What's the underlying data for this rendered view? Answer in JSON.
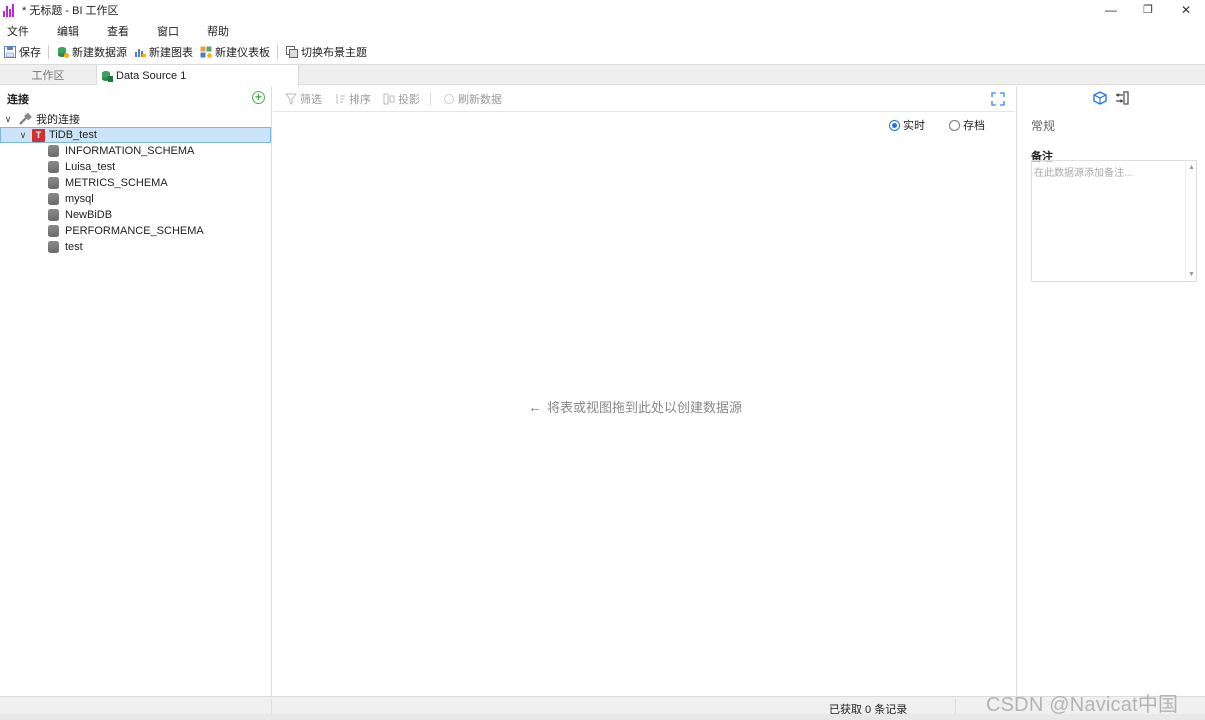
{
  "window": {
    "title": "* 无标题 - BI 工作区",
    "minimize_glyph": "—",
    "restore_glyph": "❐",
    "close_glyph": "✕"
  },
  "menu": [
    "文件",
    "编辑",
    "查看",
    "窗口",
    "帮助"
  ],
  "toolbar": {
    "save": "保存",
    "new_datasource": "新建数据源",
    "new_chart": "新建图表",
    "new_dashboard": "新建仪表板",
    "switch_theme": "切换布景主题"
  },
  "tabs": {
    "workspace": "工作区",
    "datasource": "Data Source 1"
  },
  "left": {
    "header": "连接",
    "add_glyph": "+",
    "my_connections": "我的连接",
    "connection": "TiDB_test",
    "databases": [
      "INFORMATION_SCHEMA",
      "Luisa_test",
      "METRICS_SCHEMA",
      "mysql",
      "NewBiDB",
      "PERFORMANCE_SCHEMA",
      "test"
    ]
  },
  "center": {
    "filter": "筛选",
    "sort": "排序",
    "projection": "投影",
    "refresh": "刷新数据",
    "live": "实时",
    "archive": "存档",
    "mode_selected": "live",
    "hint_arrow": "←",
    "hint": "将表或视图拖到此处以创建数据源"
  },
  "right": {
    "section": "常规",
    "notes_label": "备注",
    "notes_placeholder": "在此数据源添加备注..."
  },
  "status": {
    "records": "已获取 0 条记录"
  },
  "watermark": "CSDN @Navicat中国"
}
